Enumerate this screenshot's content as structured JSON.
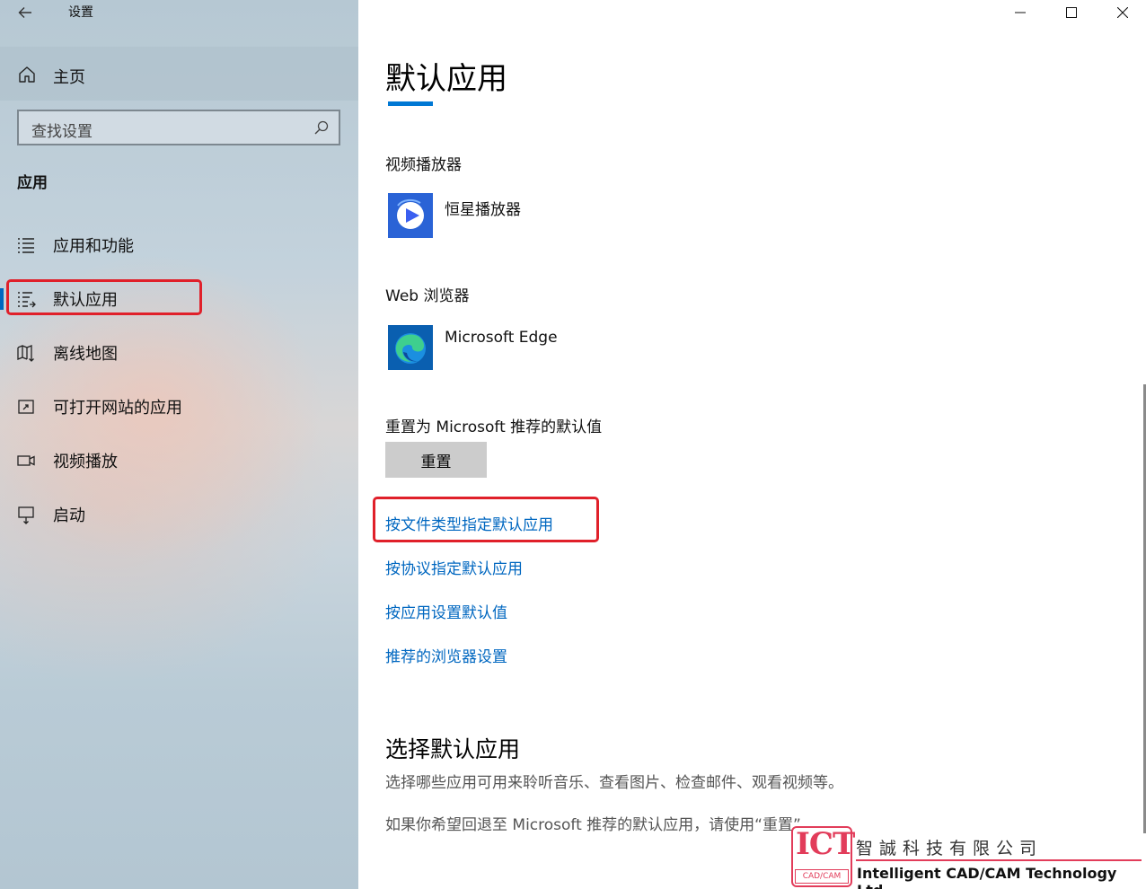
{
  "window": {
    "title": "设置",
    "controls": [
      "minimize",
      "maximize",
      "close"
    ]
  },
  "sidebar": {
    "home_label": "主页",
    "search_placeholder": "查找设置",
    "section_title": "应用",
    "items": [
      {
        "label": "应用和功能",
        "icon": "apps-features-icon",
        "active": false
      },
      {
        "label": "默认应用",
        "icon": "default-apps-icon",
        "active": true
      },
      {
        "label": "离线地图",
        "icon": "offline-maps-icon",
        "active": false
      },
      {
        "label": "可打开网站的应用",
        "icon": "apps-for-websites-icon",
        "active": false
      },
      {
        "label": "视频播放",
        "icon": "video-playback-icon",
        "active": false
      },
      {
        "label": "启动",
        "icon": "startup-icon",
        "active": false
      }
    ]
  },
  "main": {
    "title": "默认应用",
    "video_player": {
      "label": "视频播放器",
      "app_name": "恒星播放器"
    },
    "web_browser": {
      "label": "Web 浏览器",
      "app_name": "Microsoft Edge"
    },
    "reset": {
      "label": "重置为 Microsoft 推荐的默认值",
      "button": "重置"
    },
    "links": [
      "按文件类型指定默认应用",
      "按协议指定默认应用",
      "按应用设置默认值",
      "推荐的浏览器设置"
    ],
    "choose_section": {
      "title": "选择默认应用",
      "desc1": "选择哪些应用可用来聆听音乐、查看图片、检查邮件、观看视频等。",
      "desc2": "如果你希望回退至 Microsoft 推荐的默认应用，请使用“重置”。"
    }
  },
  "watermark": {
    "logo_big": "ICT",
    "logo_small": "CAD/CAM",
    "chinese": "智誠科技有限公司",
    "english": "Intelligent CAD/CAM Technology Ltd."
  },
  "colors": {
    "accent": "#0067c0",
    "highlight_box": "#e0202a",
    "logo_red": "#e23c5a"
  }
}
